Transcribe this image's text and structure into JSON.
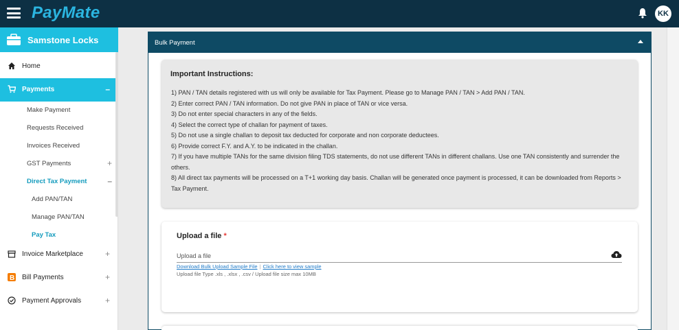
{
  "app": {
    "brand": "PayMate",
    "user_initials": "KK"
  },
  "sidebar": {
    "company": "Samstone Locks",
    "items": [
      {
        "label": "Home",
        "icon": "home-icon"
      },
      {
        "label": "Payments",
        "icon": "cart-icon",
        "toggle": "–"
      },
      {
        "label": "Invoice Marketplace",
        "icon": "storefront-icon",
        "toggle": "+"
      },
      {
        "label": "Bill Payments",
        "icon": "bill-b-icon",
        "toggle": "+"
      },
      {
        "label": "Payment Approvals",
        "icon": "check-circle-icon",
        "toggle": "+"
      }
    ],
    "payments_sub": [
      {
        "label": "Make Payment"
      },
      {
        "label": "Requests Received"
      },
      {
        "label": "Invoices Received"
      },
      {
        "label": "GST Payments",
        "toggle": "+"
      },
      {
        "label": "Direct Tax Payment",
        "toggle": "–"
      }
    ],
    "direct_tax_sub": [
      {
        "label": "Add PAN/TAN"
      },
      {
        "label": "Manage PAN/TAN"
      },
      {
        "label": "Pay Tax"
      }
    ]
  },
  "panel": {
    "title": "Bulk Payment"
  },
  "instructions": {
    "heading": "Important Instructions:",
    "items": [
      "1)   PAN / TAN details registered with us will only be available for Tax Payment. Please go to Manage PAN / TAN > Add PAN / TAN.",
      "2)   Enter correct PAN / TAN information. Do not give PAN in place of TAN or vice versa.",
      "3)   Do not enter special characters in any of the fields.",
      "4)   Select the correct type of challan for payment of taxes.",
      "5)   Do not use a single challan to deposit tax deducted for corporate and non corporate deductees.",
      "6)   Provide correct F.Y. and A.Y. to be indicated in the challan.",
      "7)   If you have multiple TANs for the same division filing TDS statements, do not use different TANs in different challans. Use one TAN consistently and surrender the others.",
      "8)   All direct tax payments will be processed on a T+1 working day basis. Challan will be generated once payment is processed, it can be downloaded from Reports > Tax Payment."
    ]
  },
  "upload": {
    "title": "Upload a file",
    "required_mark": "*",
    "placeholder": "Upload a file",
    "sample_link": "Download Bulk Upload Sample File",
    "separator": "|",
    "view_link": "Click here to view sample",
    "hint": "Upload file Type .xls , .xlsx , .csv / Upload file size max 10MB"
  },
  "colors": {
    "topbar": "#0d3044",
    "brand": "#2bb5e0",
    "accent": "#1ebfe0",
    "panel_header": "#0e4a64",
    "link": "#1e7ac8",
    "required": "#e53935"
  }
}
